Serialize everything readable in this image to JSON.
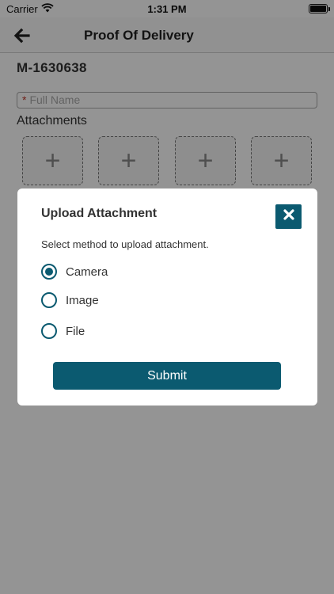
{
  "status_bar": {
    "carrier": "Carrier",
    "time": "1:31 PM"
  },
  "nav": {
    "title": "Proof Of Delivery",
    "back_icon": "arrow-left-icon"
  },
  "order": {
    "id": "M-1630638"
  },
  "form": {
    "full_name": {
      "required_marker": "*",
      "placeholder": "Full Name",
      "value": ""
    },
    "attachments_label": "Attachments",
    "slots": [
      "+",
      "+",
      "+",
      "+"
    ]
  },
  "modal": {
    "title": "Upload Attachment",
    "close_icon": "close-x-icon",
    "prompt": "Select method to upload attachment.",
    "options": [
      {
        "label": "Camera",
        "selected": true
      },
      {
        "label": "Image",
        "selected": false
      },
      {
        "label": "File",
        "selected": false
      }
    ],
    "submit_label": "Submit"
  },
  "colors": {
    "accent": "#0b5a70",
    "required": "#c0392b"
  }
}
